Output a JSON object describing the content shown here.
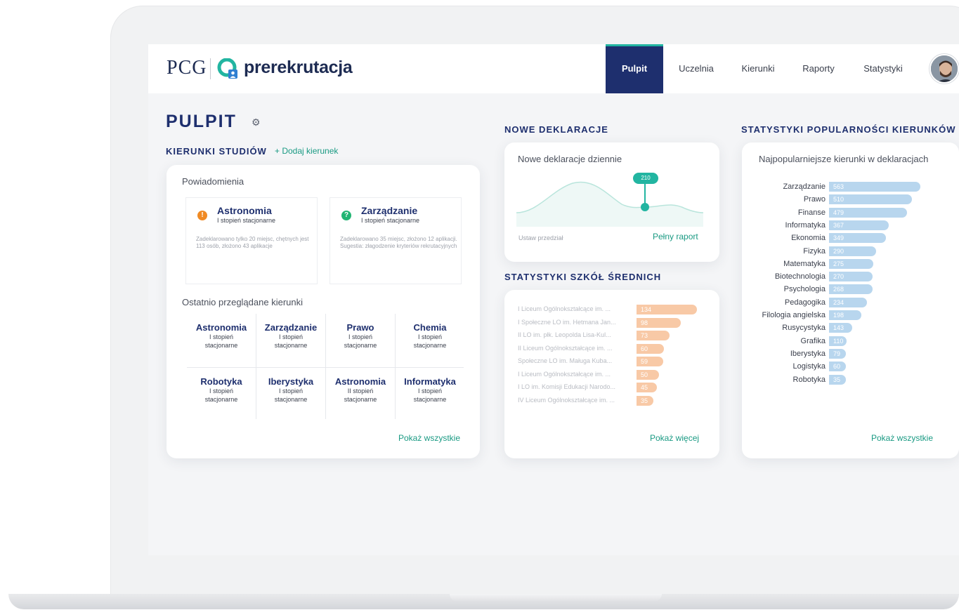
{
  "brand": {
    "pcg": "PCG",
    "name": "prerekrutacja"
  },
  "nav": [
    {
      "label": "Pulpit",
      "active": true
    },
    {
      "label": "Uczelnia",
      "active": false
    },
    {
      "label": "Kierunki",
      "active": false
    },
    {
      "label": "Raporty",
      "active": false
    },
    {
      "label": "Statystyki",
      "active": false
    }
  ],
  "page": {
    "title": "PULPIT"
  },
  "kierunki": {
    "section_title": "KIERUNKI STUDIÓW",
    "add_label": "+ Dodaj kierunek",
    "notifications_title": "Powiadomienia",
    "notifications": [
      {
        "badge": "!",
        "title": "Astronomia",
        "subtitle": "I stopień  stacjonarne",
        "text": "Zadeklarowano tylko 20 miejsc, chętnych jest 113 osób, złożono 43 aplikacje",
        "color": "#f08a24"
      },
      {
        "badge": "?",
        "title": "Zarządzanie",
        "subtitle": "I stopień  stacjonarne",
        "text": "Zadeklarowano 35 miejsc, złożono 12 aplikacji. Sugestia: złagodzenie kryteriów rekrutacyjnych",
        "color": "#22b573"
      }
    ],
    "recent_title": "Ostatnio przeglądane kierunki",
    "recent": [
      {
        "name": "Astronomia",
        "level": "I stopień",
        "mode": "stacjonarne"
      },
      {
        "name": "Zarządzanie",
        "level": "I stopień",
        "mode": "stacjonarne"
      },
      {
        "name": "Prawo",
        "level": "I stopień",
        "mode": "stacjonarne"
      },
      {
        "name": "Chemia",
        "level": "I stopień",
        "mode": "stacjonarne"
      },
      {
        "name": "Robotyka",
        "level": "I stopień",
        "mode": "stacjonarne"
      },
      {
        "name": "Iberystyka",
        "level": "I stopień",
        "mode": "stacjonarne"
      },
      {
        "name": "Astronomia",
        "level": "II stopień",
        "mode": "stacjonarne"
      },
      {
        "name": "Informatyka",
        "level": "I stopień",
        "mode": "stacjonarne"
      }
    ],
    "show_all": "Pokaż wszystkie"
  },
  "deklaracje": {
    "section_title": "NOWE DEKLARACJE",
    "card_title": "Nowe deklaracje dziennie",
    "highlight_value": "210",
    "range_label": "Ustaw przedział",
    "full_report": "Pełny raport"
  },
  "szkoly": {
    "section_title": "STATYSTYKI SZKÓŁ ŚREDNICH",
    "bar_color": "#f8c9a6",
    "items": [
      {
        "name": "I Liceum Ogólnokształcące im. ...",
        "value": 134
      },
      {
        "name": "I Społeczne LO im. Hetmana Jan...",
        "value": 98
      },
      {
        "name": "II LO im. płk. Leopolda Lisa-Kul...",
        "value": 73
      },
      {
        "name": "II Liceum Ogólnokształcące im. ...",
        "value": 60
      },
      {
        "name": "Społeczne LO im. Maługa Kuba...",
        "value": 59
      },
      {
        "name": "I Liceum Ogólnokształcące im. ...",
        "value": 50
      },
      {
        "name": "I LO im. Komisji Edukacji Narodo...",
        "value": 45
      },
      {
        "name": "IV Liceum Ogólnokształcące im. ...",
        "value": 35
      }
    ],
    "show_more": "Pokaż więcej"
  },
  "popularnosc": {
    "section_title": "STATYSTYKI POPULARNOŚCI KIERUNKÓW",
    "card_title": "Najpopularniejsze kierunki w deklaracjach",
    "bar_color": "#b8d6ee",
    "items": [
      {
        "name": "Zarządzanie",
        "value": 563
      },
      {
        "name": "Prawo",
        "value": 510
      },
      {
        "name": "Finanse",
        "value": 479
      },
      {
        "name": "Informatyka",
        "value": 367
      },
      {
        "name": "Ekonomia",
        "value": 349
      },
      {
        "name": "Fizyka",
        "value": 290
      },
      {
        "name": "Matematyka",
        "value": 275
      },
      {
        "name": "Biotechnologia",
        "value": 270
      },
      {
        "name": "Psychologia",
        "value": 268
      },
      {
        "name": "Pedagogika",
        "value": 234
      },
      {
        "name": "Filologia angielska",
        "value": 198
      },
      {
        "name": "Rusycystyka",
        "value": 143
      },
      {
        "name": "Grafika",
        "value": 110
      },
      {
        "name": "Iberystyka",
        "value": 79
      },
      {
        "name": "Logistyka",
        "value": 60
      },
      {
        "name": "Robotyka",
        "value": 35
      }
    ],
    "show_all": "Pokaż wszystkie"
  }
}
